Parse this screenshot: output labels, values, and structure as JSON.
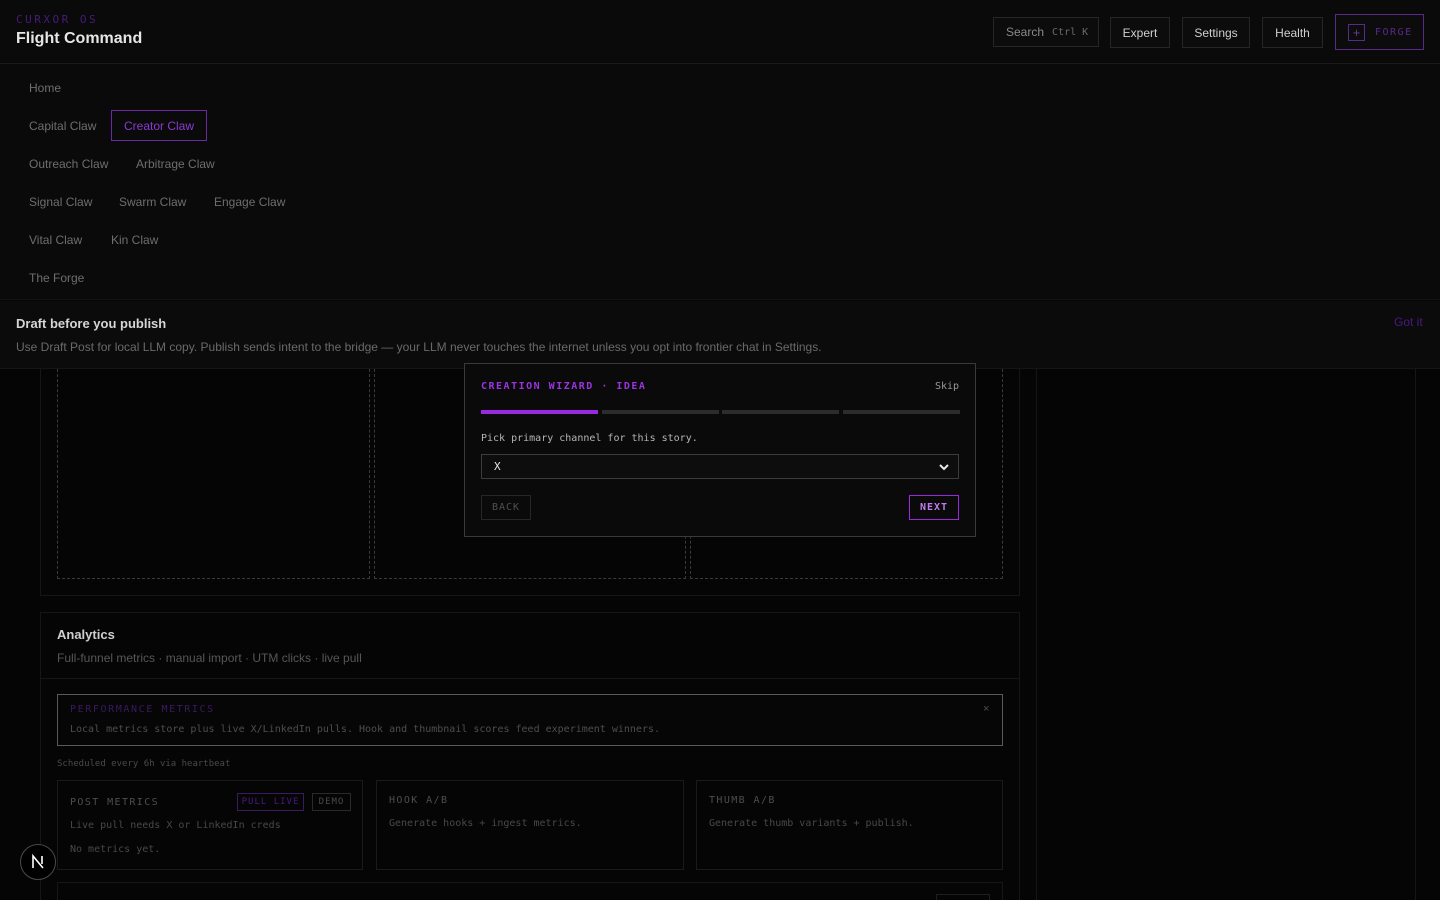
{
  "header": {
    "brand_os": "CURXOR OS",
    "title": "Flight Command",
    "search_label": "Search",
    "search_shortcut": "Ctrl K",
    "buttons": [
      "Expert",
      "Settings",
      "Health"
    ],
    "forge_label": "FORGE",
    "forge_icon": "plus-icon"
  },
  "nav": {
    "items": [
      "Home",
      "Capital Claw",
      "Creator Claw",
      "Outreach Claw",
      "Arbitrage Claw",
      "Signal Claw",
      "Swarm Claw",
      "Engage Claw",
      "Vital Claw",
      "Kin Claw",
      "The Forge"
    ],
    "active": "Creator Claw"
  },
  "banner": {
    "title": "Draft before you publish",
    "text": "Use Draft Post for local LLM copy. Publish sends intent to the bridge — your LLM never touches the internet unless you opt into frontier chat in Settings.",
    "dismiss": "Got it"
  },
  "analytics": {
    "title": "Analytics",
    "subtitle": "Full-funnel metrics · manual import · UTM clicks · live pull",
    "perf_title": "PERFORMANCE METRICS",
    "perf_text": "Local metrics store plus live X/LinkedIn pulls. Hook and thumbnail scores feed experiment winners.",
    "perf_close": "×",
    "schedule": "Scheduled every 6h via heartbeat",
    "cards": [
      {
        "title": "POST METRICS",
        "line1": "Live pull needs X or LinkedIn creds",
        "line2": "No metrics yet.",
        "pill_primary": "PULL LIVE",
        "pill_secondary": "DEMO"
      },
      {
        "title": "HOOK A/B",
        "line1": "Generate hooks + ingest metrics."
      },
      {
        "title": "THUMB A/B",
        "line1": "Generate thumb variants + publish."
      }
    ]
  },
  "wizard": {
    "title": "CREATION WIZARD · IDEA",
    "skip": "Skip",
    "steps_total": 4,
    "current_step": 1,
    "prompt": "Pick primary channel for this story.",
    "selected": "X",
    "back": "BACK",
    "next": "NEXT"
  },
  "colors": {
    "accent": "#9a28e0",
    "background": "#050505"
  }
}
